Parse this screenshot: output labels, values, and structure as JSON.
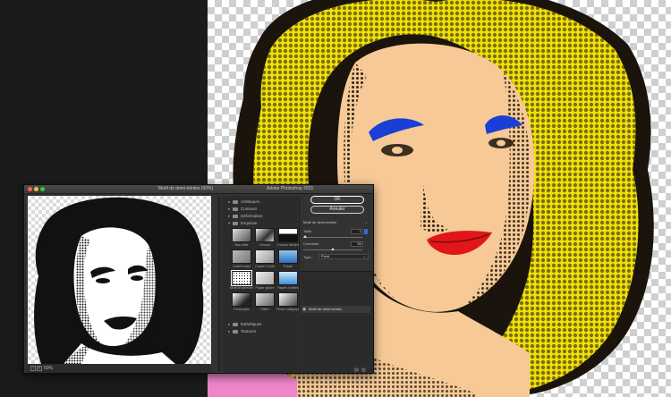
{
  "window": {
    "filter_dialog_title": "Motif de demi-teintes (50%)",
    "app_title": "Adobe Photoshop 2021"
  },
  "preview": {
    "zoom": "50%",
    "zoom_out": "−",
    "zoom_in": "+"
  },
  "gallery": {
    "folders": [
      {
        "label": "Artistiques",
        "expanded": false
      },
      {
        "label": "Contours",
        "expanded": false
      },
      {
        "label": "Déformation",
        "expanded": false
      },
      {
        "label": "Esquisse",
        "expanded": true
      },
      {
        "label": "Esthétiques",
        "expanded": false
      },
      {
        "label": "Textures",
        "expanded": false
      }
    ],
    "thumbnails": [
      {
        "label": "Bas-relief"
      },
      {
        "label": "Chrome"
      },
      {
        "label": "Contour déchiré"
      },
      {
        "label": "Craie/Fusain"
      },
      {
        "label": "Crayon Conté"
      },
      {
        "label": "Fusain"
      },
      {
        "label": "Motif de demi-teintes"
      },
      {
        "label": "Papier gaufré"
      },
      {
        "label": "Papier à lettres"
      },
      {
        "label": "Photocopie"
      },
      {
        "label": "Plâtre"
      },
      {
        "label": "Plume calligraphique"
      }
    ]
  },
  "controls": {
    "ok_label": "OK",
    "cancel_label": "Annuler",
    "filter_name": "Motif de demi-teintes",
    "size_label": "Taille",
    "size_value": "1",
    "contrast_label": "Contraste",
    "contrast_value": "50",
    "type_label": "Type :",
    "type_value": "Point",
    "layer_name": "Motif de demi-teintes"
  },
  "colors": {
    "hair": "#f2e10a",
    "skin": "#f6c996",
    "eyeshadow": "#1a3fd6",
    "lips": "#e0161b",
    "outfit": "#ef86c8",
    "shadow": "#1a140c"
  }
}
